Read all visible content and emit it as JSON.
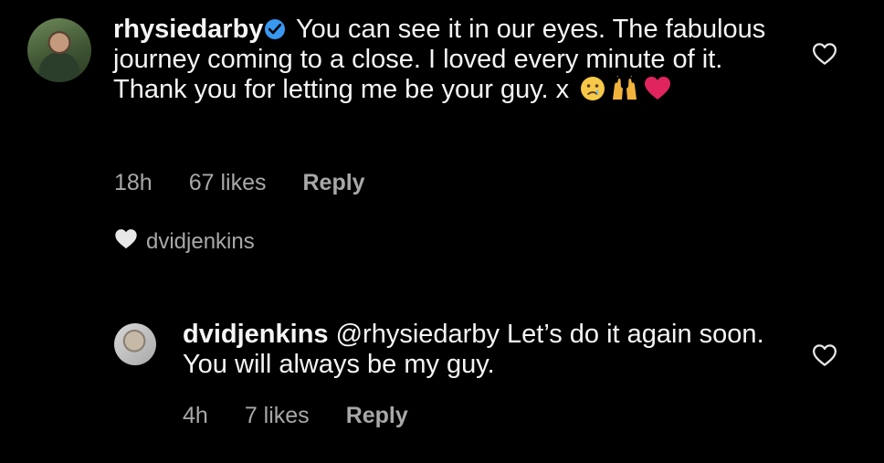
{
  "comments": [
    {
      "username": "rhysiedarby",
      "verified": true,
      "text": "You can see it in our eyes. The fabulous journey coming to a close. I loved every minute of it. Thank you for letting me be your guy. x",
      "emojis": [
        "crying-face",
        "raising-hands",
        "red-heart"
      ],
      "time": "18h",
      "likes": "67 likes",
      "reply_label": "Reply",
      "liked_by": "dvidjenkins"
    },
    {
      "username": "dvidjenkins",
      "text": "@rhysiedarby Let’s do it again soon. You will always be my guy.",
      "time": "4h",
      "likes": "7 likes",
      "reply_label": "Reply"
    }
  ],
  "icons": {
    "like": "heart-outline-icon",
    "liked_by": "heart-filled-icon",
    "verified": "verified-badge-icon"
  },
  "colors": {
    "background": "#000000",
    "text": "#f5f5f5",
    "meta": "#a8a8a8",
    "verified": "#3897f0",
    "heart_emoji": "#e0245e"
  }
}
